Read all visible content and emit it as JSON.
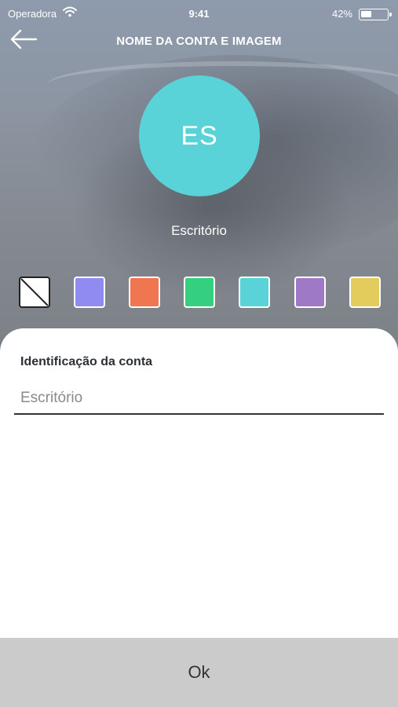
{
  "status_bar": {
    "carrier": "Operadora",
    "time": "9:41",
    "battery_percent": "42%",
    "battery_level": 0.42
  },
  "header": {
    "title": "NOME DA CONTA E IMAGEM",
    "back_icon": "arrow-left-icon"
  },
  "avatar": {
    "initials": "ES",
    "color": "#5ad3d8"
  },
  "account": {
    "name": "Escritório"
  },
  "color_palette": [
    {
      "name": "none",
      "color": "#ffffff"
    },
    {
      "name": "periwinkle",
      "color": "#8f8bf0"
    },
    {
      "name": "coral",
      "color": "#ef7651"
    },
    {
      "name": "green",
      "color": "#34d07f"
    },
    {
      "name": "turquoise",
      "color": "#5ad3d8"
    },
    {
      "name": "lavender",
      "color": "#9f79c6"
    },
    {
      "name": "mustard",
      "color": "#e4cb5e"
    }
  ],
  "form": {
    "label": "Identificação da conta",
    "placeholder": "Escritório",
    "value": ""
  },
  "footer": {
    "ok_label": "Ok"
  }
}
